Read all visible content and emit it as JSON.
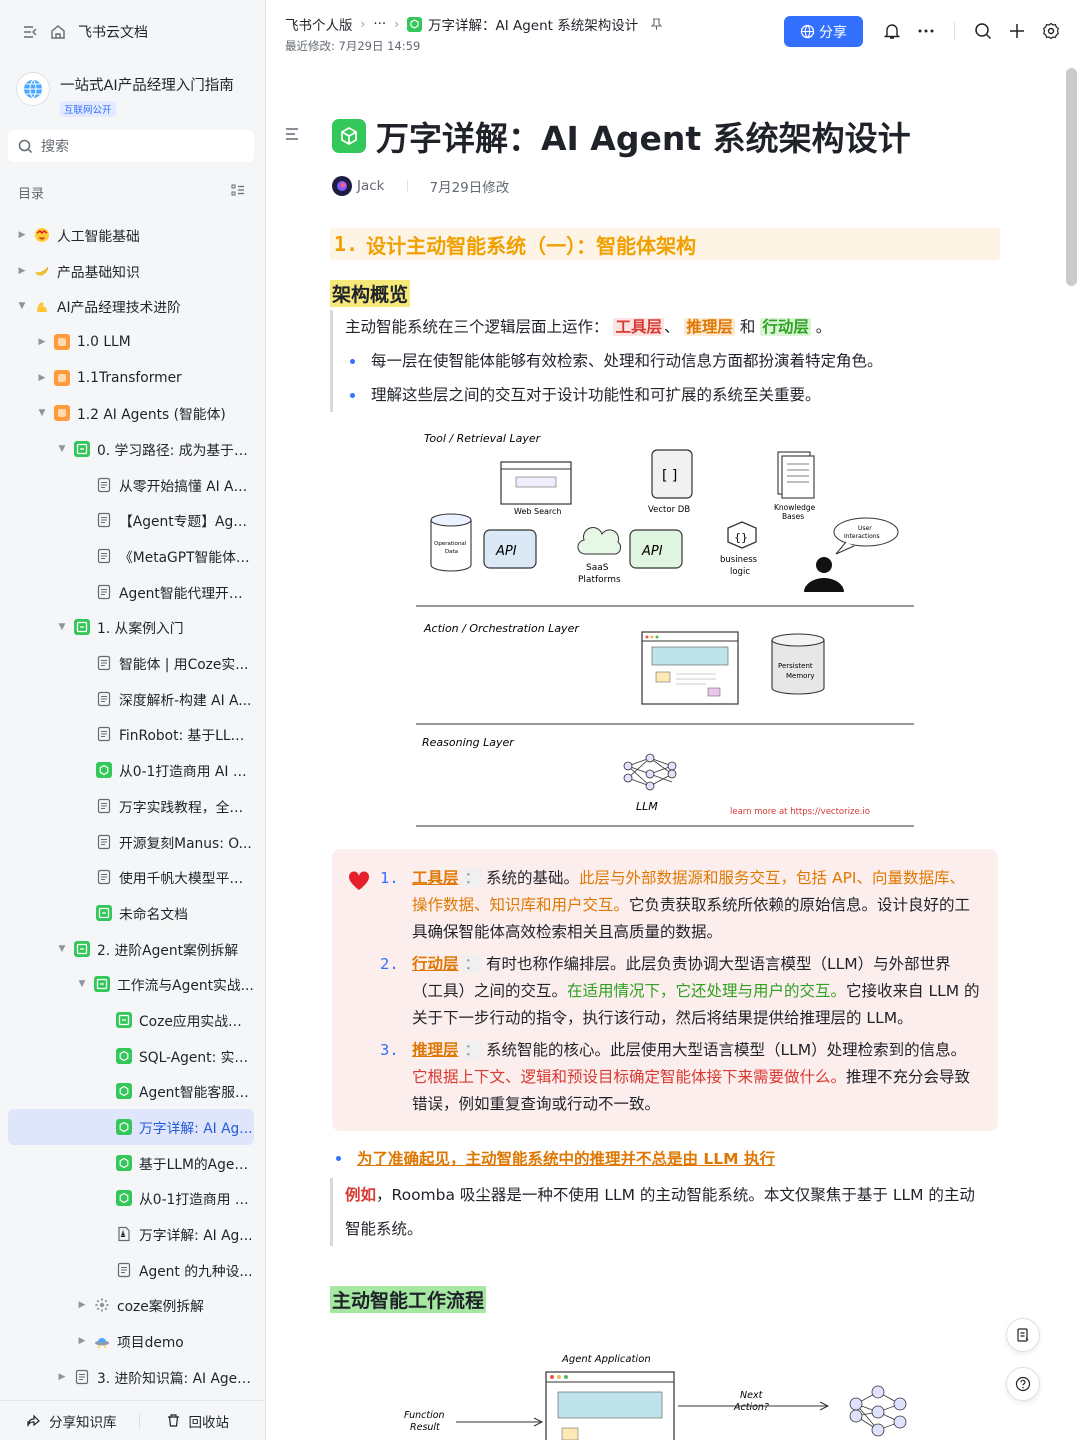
{
  "sidebar": {
    "top_label": "飞书云文档",
    "kb_title": "一站式AI产品经理入门指南",
    "kb_badge": "互联网公开",
    "search_placeholder": "搜索",
    "toc_label": "目录",
    "tree": [
      {
        "label": "人工智能基础",
        "depth": 0,
        "arrow": "right",
        "icon": "emoji-face-icon"
      },
      {
        "label": "产品基础知识",
        "depth": 0,
        "arrow": "right",
        "icon": "emoji-banana-icon"
      },
      {
        "label": "AI产品经理技术进阶",
        "depth": 0,
        "arrow": "down",
        "icon": "emoji-muscle-icon"
      },
      {
        "label": "1.0 LLM",
        "depth": 1,
        "arrow": "right",
        "icon": "orange-app-icon"
      },
      {
        "label": "1.1Transformer",
        "depth": 1,
        "arrow": "right",
        "icon": "orange-app-icon"
      },
      {
        "label": "1.2 AI Agents (智能体)",
        "depth": 1,
        "arrow": "down",
        "icon": "orange-app-icon"
      },
      {
        "label": "0. 学习路径: 成为基于A...",
        "depth": 2,
        "arrow": "down",
        "icon": "green-board-icon"
      },
      {
        "label": "从零开始搞懂 AI Ag...",
        "depth": 3,
        "arrow": "none",
        "icon": "doc-icon"
      },
      {
        "label": "【Agent专题】Agen...",
        "depth": 3,
        "arrow": "none",
        "icon": "doc-icon"
      },
      {
        "label": "《MetaGPT智能体开...",
        "depth": 3,
        "arrow": "none",
        "icon": "doc-icon"
      },
      {
        "label": "Agent智能代理开发...",
        "depth": 3,
        "arrow": "none",
        "icon": "doc-icon"
      },
      {
        "label": "1. 从案例入门",
        "depth": 2,
        "arrow": "down",
        "icon": "green-board-icon"
      },
      {
        "label": "智能体 | 用Coze实...",
        "depth": 3,
        "arrow": "none",
        "icon": "doc-icon"
      },
      {
        "label": "深度解析-构建 AI A...",
        "depth": 3,
        "arrow": "none",
        "icon": "doc-icon"
      },
      {
        "label": "FinRobot: 基于LLM...",
        "depth": 3,
        "arrow": "none",
        "icon": "doc-icon"
      },
      {
        "label": "从0-1打造商用 AI A...",
        "depth": 3,
        "arrow": "none",
        "icon": "green-cube-icon"
      },
      {
        "label": "万字实践教程，全面...",
        "depth": 3,
        "arrow": "none",
        "icon": "doc-icon"
      },
      {
        "label": "开源复刻Manus: O...",
        "depth": 3,
        "arrow": "none",
        "icon": "doc-icon"
      },
      {
        "label": "使用千帆大模型平台...",
        "depth": 3,
        "arrow": "none",
        "icon": "doc-icon"
      },
      {
        "label": "未命名文档",
        "depth": 3,
        "arrow": "none",
        "icon": "green-board-icon"
      },
      {
        "label": "2. 进阶Agent案例拆解",
        "depth": 2,
        "arrow": "down",
        "icon": "green-board-icon"
      },
      {
        "label": "工作流与Agent实战...",
        "depth": 3,
        "arrow": "down",
        "icon": "green-board-icon"
      },
      {
        "label": "Coze应用实战指南",
        "depth": 4,
        "arrow": "none",
        "icon": "green-board-icon"
      },
      {
        "label": "SQL-Agent: 实现...",
        "depth": 4,
        "arrow": "none",
        "icon": "green-cube-icon"
      },
      {
        "label": "Agent智能客服，...",
        "depth": 4,
        "arrow": "none",
        "icon": "green-cube-icon"
      },
      {
        "label": "万字详解: AI Ag...",
        "depth": 4,
        "arrow": "none",
        "icon": "green-cube-icon",
        "active": true
      },
      {
        "label": "基于LLM的Agent...",
        "depth": 4,
        "arrow": "none",
        "icon": "green-cube-icon"
      },
      {
        "label": "从0-1打造商用 A...",
        "depth": 4,
        "arrow": "none",
        "icon": "green-cube-icon"
      },
      {
        "label": "万字详解: AI Ag...",
        "depth": 4,
        "arrow": "none",
        "icon": "pdf-icon"
      },
      {
        "label": "Agent 的九种设...",
        "depth": 4,
        "arrow": "none",
        "icon": "doc-icon"
      },
      {
        "label": "coze案例拆解",
        "depth": 3,
        "arrow": "right",
        "icon": "gear-icon"
      },
      {
        "label": "项目demo",
        "depth": 3,
        "arrow": "right",
        "icon": "emoji-ufo-icon"
      },
      {
        "label": "3. 进阶知识篇: AI Agen...",
        "depth": 2,
        "arrow": "right",
        "icon": "doc-icon"
      }
    ],
    "share_kb": "分享知识库",
    "recycle": "回收站"
  },
  "topbar": {
    "crumb_root": "飞书个人版",
    "crumb_more": "···",
    "crumb_current": "万字详解：AI Agent 系统架构设计",
    "modified": "最近修改: 7月29日 14:59",
    "share": "分享"
  },
  "doc": {
    "title": "万字详解：AI Agent 系统架构设计",
    "author": "Jack",
    "modified": "7月29日修改",
    "h1_num": "1.",
    "h1_text": "设计主动智能系统（一）：智能体架构",
    "h2_overview": "架构概览",
    "overview": {
      "intro": "主动智能系统在三个逻辑层面上运作：",
      "tool": "工具层",
      "sep1": "、",
      "reason": "推理层",
      "and": "和",
      "action": "行动层",
      "end": "。",
      "b1": "每一层在使智能体能够有效检索、处理和行动信息方面都扮演着特定角色。",
      "b2": "理解这些层之间的交互对于设计功能性和可扩展的系统至关重要。"
    },
    "diagram": {
      "tool_layer": "Tool / Retrieval Layer",
      "web_search": "Web Search",
      "vector_db": "Vector DB",
      "knowledge": "Knowledge",
      "bases": "Bases",
      "operational": "Operational",
      "data": "Data",
      "api": "API",
      "saas": "SaaS",
      "platforms": "Platforms",
      "business": "business",
      "logic": "logic",
      "user": "User",
      "interactions": "Interactions",
      "action_layer": "Action / Orchestration Layer",
      "persistent": "Persistent",
      "memory": "Memory",
      "reasoning_layer": "Reasoning Layer",
      "llm": "LLM",
      "learn_more": "learn more at https://vectorize.io"
    },
    "callout": {
      "n1": "1.",
      "t1_tag": "工具层",
      "t1_a": "系统的基础。",
      "t1_b": "此层与外部数据源和服务交互，包括 API、向量数据库、操作数据、知识库和用户交互。",
      "t1_c": "它负责获取系统所依赖的原始信息。设计良好的工具确保智能体高效检索相关且高质量的数据。",
      "n2": "2.",
      "t2_tag": "行动层",
      "t2_a": "有时也称作编排层。此层负责协调大型语言模型（LLM）与外部世界（工具）之间的交互。",
      "t2_b": "在适用情况下，它还处理与用户的交互。",
      "t2_c": "它接收来自 LLM 的关于下一步行动的指令，执行该行动，然后将结果提供给推理层的 LLM。",
      "n3": "3.",
      "t3_tag": "推理层",
      "t3_a": "系统智能的核心。此层使用大型语言模型（LLM）处理检索到的信息。",
      "t3_b": "它根据上下文、逻辑和预设目标确定智能体接下来需要做什么。",
      "t3_c": "推理不充分会导致错误，例如重复查询或行动不一致。",
      "colon": "："
    },
    "note_title": "为了准确起见，主动智能系统中的推理并不总是由 LLM 执行",
    "note_q1": "例如",
    "note_q2": "，Roomba 吸尘器是一种不使用 LLM 的主动智能系统。本文仅聚焦于基于 LLM 的主动",
    "note_q3": "智能系统。",
    "h2_workflow": "主动智能工作流程",
    "flow": {
      "agent_app": "Agent Application",
      "function": "Function",
      "result": "Result",
      "next": "Next",
      "action": "Action?"
    }
  },
  "colors": {
    "accent": "#3370ff",
    "orange": "#de7802",
    "red": "#d83931",
    "green": "#2ea121",
    "active_bg": "#dfe6fb"
  }
}
